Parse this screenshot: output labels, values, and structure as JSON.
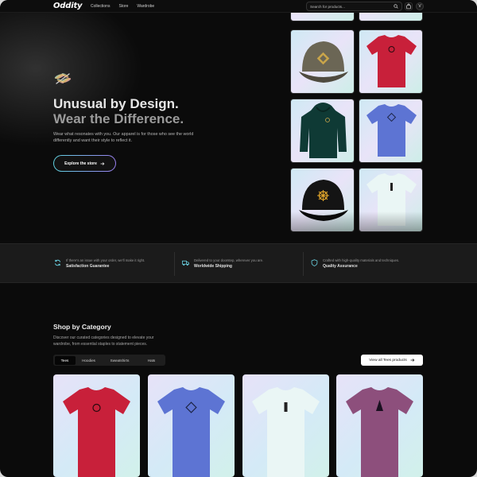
{
  "nav": {
    "logo": "Oddity",
    "links": [
      "Collections",
      "Store",
      "Wardrobe"
    ],
    "search_placeholder": "Search for products...",
    "avatar_initial": "V"
  },
  "hero": {
    "title_line1": "Unusual by Design.",
    "title_line2": "Wear the Difference.",
    "description": "Wear what resonates with you. Our apparel is for those who see the world differently and want their style to reflect it.",
    "cta_label": "Explore the store",
    "products": [
      {
        "name": "olive cap",
        "color": "#6b6655"
      },
      {
        "name": "red tee",
        "color": "#c8203a"
      },
      {
        "name": "green hoodie",
        "color": "#0f3a35"
      },
      {
        "name": "blue tee",
        "color": "#5d74d3"
      },
      {
        "name": "black cap",
        "color": "#141414"
      },
      {
        "name": "white tee",
        "color": "#eaf6f5"
      }
    ]
  },
  "features": [
    {
      "icon": "refresh-icon",
      "caption": "If there's an issue with your order, we'll make it right.",
      "title": "Satisfaction Guarantee"
    },
    {
      "icon": "truck-icon",
      "caption": "Delivered to your doorstep, wherever you are.",
      "title": "Worldwide Shipping"
    },
    {
      "icon": "shield-icon",
      "caption": "Crafted with high-quality materials and techniques.",
      "title": "Quality Assurance"
    }
  ],
  "category": {
    "title": "Shop by Category",
    "description": "Discover our curated categories designed to elevate your wardrobe, from essential staples to statement pieces.",
    "tabs": [
      "Tees",
      "Hoodies",
      "Sweatshirts",
      "Hats"
    ],
    "active_tab": "Tees",
    "view_all_label": "View all Tees products",
    "cards": [
      {
        "color": "#c8203a"
      },
      {
        "color": "#5d74d3"
      },
      {
        "color": "#eaf6f5"
      },
      {
        "color": "#8d4f7c"
      }
    ]
  },
  "accent_gradient": [
    "#5fd2e0",
    "#9a7ff0"
  ]
}
